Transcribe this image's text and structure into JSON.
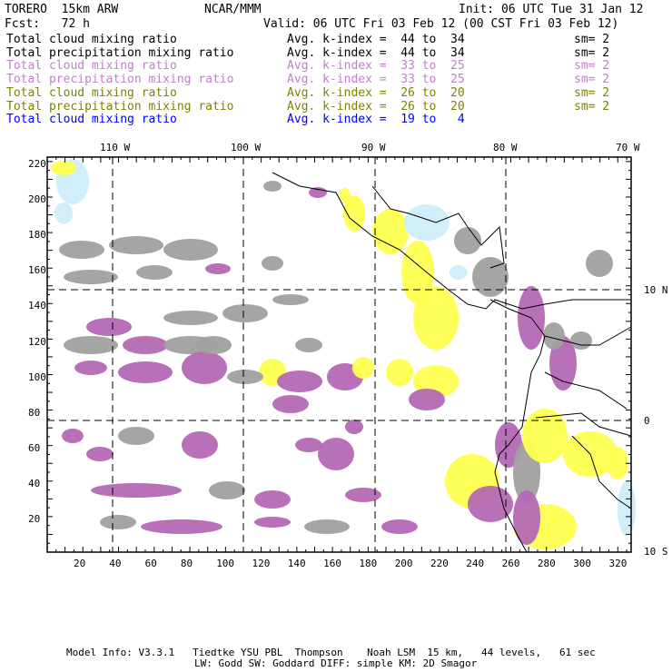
{
  "header": {
    "model": "TORERO  15km ARW",
    "org": "NCAR/MMM",
    "init": "Init: 06 UTC Tue 31 Jan 12",
    "fcst": "Fcst:   72 h",
    "valid": "Valid: 06 UTC Fri 03 Feb 12 (00 CST Fri 03 Feb 12)"
  },
  "legend": [
    {
      "field": "Total cloud mixing ratio",
      "range": "Avg. k-index =  44 to  34",
      "sm": "sm= 2",
      "color": "#000000"
    },
    {
      "field": "Total precipitation mixing ratio",
      "range": "Avg. k-index =  44 to  34",
      "sm": "sm= 2",
      "color": "#000000"
    },
    {
      "field": "Total cloud mixing ratio",
      "range": "Avg. k-index =  33 to  25",
      "sm": "sm= 2",
      "color": "#c080c8"
    },
    {
      "field": "Total precipitation mixing ratio",
      "range": "Avg. k-index =  33 to  25",
      "sm": "sm= 2",
      "color": "#c080c8"
    },
    {
      "field": "Total cloud mixing ratio",
      "range": "Avg. k-index =  26 to  20",
      "sm": "sm= 2",
      "color": "#808000"
    },
    {
      "field": "Total precipitation mixing ratio",
      "range": "Avg. k-index =  26 to  20",
      "sm": "sm= 2",
      "color": "#808000"
    },
    {
      "field": "Total cloud mixing ratio",
      "range": "Avg. k-index =  19 to   4",
      "sm": "",
      "color": "#0000ff"
    }
  ],
  "map": {
    "lon_labels": [
      "110 W",
      "100 W",
      "90 W",
      "80 W",
      "70 W"
    ],
    "lat_labels": [
      "10 N",
      "0",
      "10 S"
    ],
    "x_ticks": [
      "20",
      "40",
      "60",
      "80",
      "100",
      "120",
      "140",
      "160",
      "180",
      "200",
      "220",
      "240",
      "260",
      "280",
      "300",
      "320"
    ],
    "y_ticks": [
      "20",
      "40",
      "60",
      "80",
      "100",
      "120",
      "140",
      "160",
      "180",
      "200",
      "220"
    ],
    "colors": {
      "gray": "#a0a0a0",
      "purple": "#b468b4",
      "yellow": "#ffff50",
      "lightblue": "#cdeefa"
    }
  },
  "footer": {
    "line1": "Model Info: V3.3.1   Tiedtke YSU PBL  Thompson    Noah LSM  15 km,   44 levels,   61 sec",
    "line2": "LW: Godd SW: Goddard DIFF: simple KM: 2D Smagor"
  }
}
